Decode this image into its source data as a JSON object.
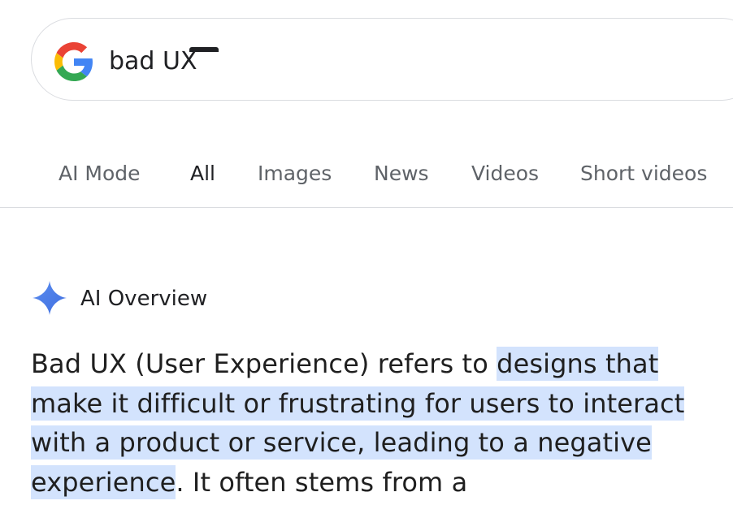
{
  "search": {
    "query": "bad UX",
    "logo_icon": "google-g-icon"
  },
  "tabs": [
    {
      "label": "AI Mode",
      "active": false
    },
    {
      "label": "All",
      "active": true
    },
    {
      "label": "Images",
      "active": false
    },
    {
      "label": "News",
      "active": false
    },
    {
      "label": "Videos",
      "active": false
    },
    {
      "label": "Short videos",
      "active": false
    }
  ],
  "ai_overview": {
    "icon": "gemini-sparkle-icon",
    "label": "AI Overview",
    "text_before": "Bad UX (User Experience) refers to ",
    "text_highlighted": "designs that make it difficult or frustrating for users to interact with a product or service, leading to a negative experience",
    "text_after": ". It often stems from a"
  },
  "colors": {
    "highlight": "#d3e3fd",
    "sparkle": "#4f7fe8",
    "active_tab": "#202124",
    "inactive_tab": "#5f6368"
  }
}
